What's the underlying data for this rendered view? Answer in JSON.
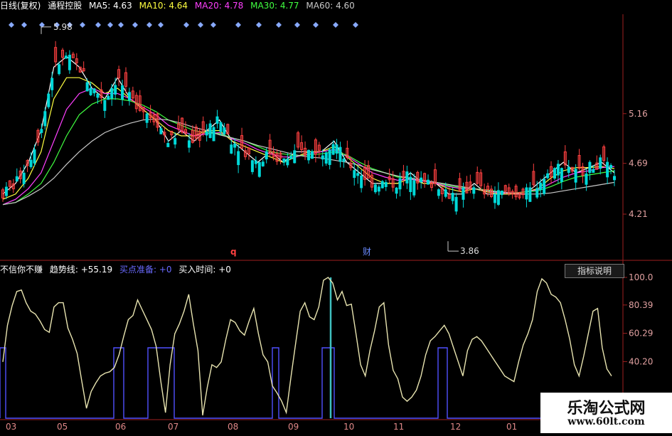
{
  "header": {
    "period": "日线(复权)",
    "stock": "通程控股",
    "ma5": "MA5: 4.63",
    "ma10": "MA10: 4.64",
    "ma20": "MA20: 4.78",
    "ma30": "MA30: 4.77",
    "ma60": "MA60: 4.60"
  },
  "indicator_header": {
    "name": "不信你不赚",
    "trend": "趋势线: +55.19",
    "buy_ready": "买点准备: +0",
    "buy_time": "买入时间: +0"
  },
  "indicator_button": "指标说明",
  "markers": {
    "q": "q",
    "cai": "财"
  },
  "watermark": {
    "line1": "乐淘公式网",
    "line2": "www.60lt.com"
  },
  "colors": {
    "up": "#ff4040",
    "down": "#00d8d8",
    "ma5": "#ffffff",
    "ma10": "#ffff40",
    "ma20": "#ff40ff",
    "ma30": "#40ff40",
    "ma60": "#c8c8c8",
    "trend": "#e8e4b0",
    "buy": "#5050ff",
    "axis": "#a02020",
    "label": "#e0a0a0"
  },
  "chart_data": [
    {
      "type": "line",
      "title": "日线(复权)",
      "price_ticks": [
        "5.16",
        "4.69",
        "4.21"
      ],
      "price_range": [
        3.8,
        6.1
      ],
      "annotations": [
        {
          "label": "5.98",
          "value": 5.98,
          "kind": "high"
        },
        {
          "label": "3.86",
          "value": 3.86,
          "kind": "low"
        }
      ],
      "series": [
        {
          "name": "MA5",
          "values": [
            4.4,
            4.5,
            4.7,
            5.0,
            5.6,
            5.7,
            5.6,
            5.4,
            5.3,
            5.5,
            5.3,
            5.2,
            5.1,
            4.9,
            5.0,
            4.9,
            5.0,
            5.1,
            4.9,
            4.8,
            4.7,
            4.8,
            4.7,
            4.8,
            4.8,
            4.8,
            4.9,
            4.7,
            4.6,
            4.5,
            4.5,
            4.5,
            4.6,
            4.5,
            4.5,
            4.4,
            4.4,
            4.5,
            4.4,
            4.4,
            4.4,
            4.4,
            4.5,
            4.6,
            4.7,
            4.6,
            4.65,
            4.7,
            4.6
          ]
        },
        {
          "name": "MA10",
          "values": [
            4.35,
            4.4,
            4.55,
            4.8,
            5.3,
            5.5,
            5.5,
            5.45,
            5.35,
            5.4,
            5.3,
            5.2,
            5.1,
            5.0,
            4.95,
            4.95,
            5.0,
            5.0,
            4.9,
            4.85,
            4.8,
            4.75,
            4.7,
            4.75,
            4.8,
            4.8,
            4.85,
            4.75,
            4.65,
            4.55,
            4.5,
            4.5,
            4.55,
            4.5,
            4.5,
            4.45,
            4.42,
            4.45,
            4.42,
            4.4,
            4.4,
            4.42,
            4.45,
            4.55,
            4.62,
            4.65,
            4.65,
            4.66,
            4.64
          ]
        },
        {
          "name": "MA20",
          "values": [
            4.3,
            4.35,
            4.45,
            4.6,
            4.9,
            5.2,
            5.35,
            5.4,
            5.35,
            5.35,
            5.3,
            5.22,
            5.15,
            5.05,
            5.0,
            4.95,
            4.97,
            4.98,
            4.92,
            4.88,
            4.82,
            4.78,
            4.75,
            4.75,
            4.78,
            4.8,
            4.82,
            4.76,
            4.68,
            4.6,
            4.56,
            4.53,
            4.54,
            4.52,
            4.5,
            4.47,
            4.45,
            4.45,
            4.43,
            4.41,
            4.41,
            4.42,
            4.44,
            4.5,
            4.56,
            4.6,
            4.62,
            4.65,
            4.66
          ]
        },
        {
          "name": "MA30",
          "values": [
            4.3,
            4.32,
            4.4,
            4.5,
            4.7,
            4.95,
            5.15,
            5.25,
            5.3,
            5.3,
            5.28,
            5.24,
            5.18,
            5.1,
            5.05,
            5.0,
            4.98,
            4.97,
            4.93,
            4.9,
            4.85,
            4.8,
            4.78,
            4.76,
            4.77,
            4.78,
            4.8,
            4.77,
            4.7,
            4.64,
            4.6,
            4.56,
            4.55,
            4.53,
            4.51,
            4.48,
            4.46,
            4.45,
            4.44,
            4.42,
            4.41,
            4.42,
            4.43,
            4.47,
            4.52,
            4.56,
            4.58,
            4.6,
            4.62
          ]
        },
        {
          "name": "MA60",
          "values": [
            4.3,
            4.32,
            4.38,
            4.45,
            4.55,
            4.68,
            4.8,
            4.9,
            4.98,
            5.03,
            5.07,
            5.1,
            5.11,
            5.1,
            5.07,
            5.03,
            5.0,
            4.96,
            4.93,
            4.9,
            4.86,
            4.83,
            4.8,
            4.77,
            4.75,
            4.74,
            4.72,
            4.7,
            4.67,
            4.63,
            4.6,
            4.57,
            4.55,
            4.53,
            4.51,
            4.49,
            4.47,
            4.45,
            4.43,
            4.42,
            4.41,
            4.4,
            4.4,
            4.41,
            4.43,
            4.45,
            4.47,
            4.49,
            4.51
          ]
        }
      ]
    },
    {
      "type": "line",
      "title": "不信你不赚",
      "ylim": [
        0,
        100
      ],
      "y_ticks": [
        "100.0",
        "80.39",
        "60.29",
        "40.20"
      ],
      "x_ticks": [
        "03",
        "05",
        "06",
        "07",
        "08",
        "09",
        "10",
        "11",
        "12",
        "01"
      ],
      "series": [
        {
          "name": "趋势线",
          "values": [
            40,
            66,
            80,
            90,
            91,
            82,
            76,
            74,
            69,
            63,
            61,
            79,
            82,
            82,
            64,
            56,
            46,
            26,
            7,
            19,
            25,
            30,
            32,
            33,
            36,
            45,
            58,
            70,
            73,
            84,
            77,
            70,
            63,
            51,
            26,
            4,
            38,
            60,
            67,
            76,
            88,
            67,
            48,
            2,
            22,
            38,
            36,
            40,
            56,
            70,
            68,
            62,
            59,
            69,
            78,
            60,
            45,
            40,
            23,
            18,
            12,
            4,
            29,
            53,
            76,
            82,
            72,
            70,
            79,
            98,
            100,
            96,
            84,
            90,
            80,
            81,
            60,
            38,
            30,
            48,
            62,
            79,
            82,
            52,
            34,
            28,
            15,
            12,
            15,
            20,
            30,
            45,
            55,
            58,
            62,
            66,
            60,
            50,
            40,
            30,
            48,
            56,
            58,
            55,
            50,
            45,
            40,
            35,
            30,
            28,
            26,
            40,
            52,
            60,
            70,
            90,
            99,
            96,
            88,
            86,
            82,
            70,
            56,
            38,
            30,
            44,
            60,
            76,
            78,
            50,
            35,
            30
          ]
        }
      ]
    }
  ]
}
